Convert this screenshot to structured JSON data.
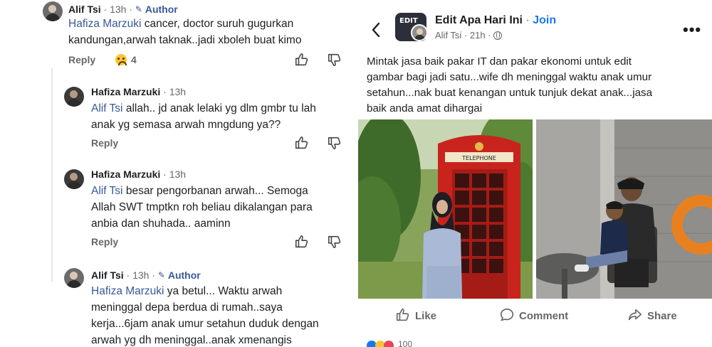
{
  "left_panel": {
    "comments": [
      {
        "name": "Alif Tsi",
        "time": "13h",
        "author_badge": "Author",
        "mention": "Hafiza Marzuki",
        "line1": " cancer, doctor suruh gugurkan",
        "line2": "kandungan,arwah taknak..jadi xboleh buat kimo",
        "reply": "Reply",
        "reaction_count": "4"
      },
      {
        "name": "Hafiza Marzuki",
        "time": "13h",
        "mention": "Alif Tsi",
        "line1": " allah.. jd anak lelaki yg dlm gmbr tu lah",
        "line2": "anak yg semasa arwah mngdung ya??",
        "reply": "Reply"
      },
      {
        "name": "Hafiza Marzuki",
        "time": "13h",
        "mention": "Alif Tsi",
        "line1": " besar pengorbanan arwah... Semoga",
        "line2": "Allah SWT tmptkn roh beliau dikalangan para",
        "line3": "anbia dan shuhada.. aaminn",
        "reply": "Reply"
      },
      {
        "name": "Alif Tsi",
        "time": "13h",
        "author_badge": "Author",
        "mention": "Hafiza Marzuki",
        "line1": " ya betul... Waktu arwah",
        "line2": "meninggal depa berdua di rumah..saya",
        "line3": "kerja...6jam anak umur setahun duduk dengan",
        "line4": "arwah yg dh meninggal..anak xmenangis"
      }
    ],
    "separator": "·"
  },
  "right_panel": {
    "group_name": "Edit Apa Hari Ini",
    "join_label": "Join",
    "group_avatar_text": "EDIT",
    "poster_name": "Alif Tsi",
    "post_time": "21h",
    "post_text_lines": [
      "Mintak jasa baik pakar IT dan pakar ekonomi untuk edit",
      "gambar bagi jadi satu...wife dh meninggal waktu anak umur",
      "setahun...nak buat kenangan untuk tunjuk dekat anak...jasa",
      "baik anda amat dihargai"
    ],
    "phone_box_sign": "TELEPHONE",
    "actions": {
      "like": "Like",
      "comment": "Comment",
      "share": "Share"
    },
    "reaction_count_partial": "100"
  },
  "icons": [
    "back-icon",
    "more-icon",
    "globe-icon",
    "pen-icon",
    "like-icon",
    "dislike-icon",
    "comment-icon",
    "share-icon",
    "sad-reaction-icon"
  ],
  "colors": {
    "link": "#385898",
    "join": "#1877f2",
    "muted": "#65676b",
    "text": "#1c1e21"
  }
}
